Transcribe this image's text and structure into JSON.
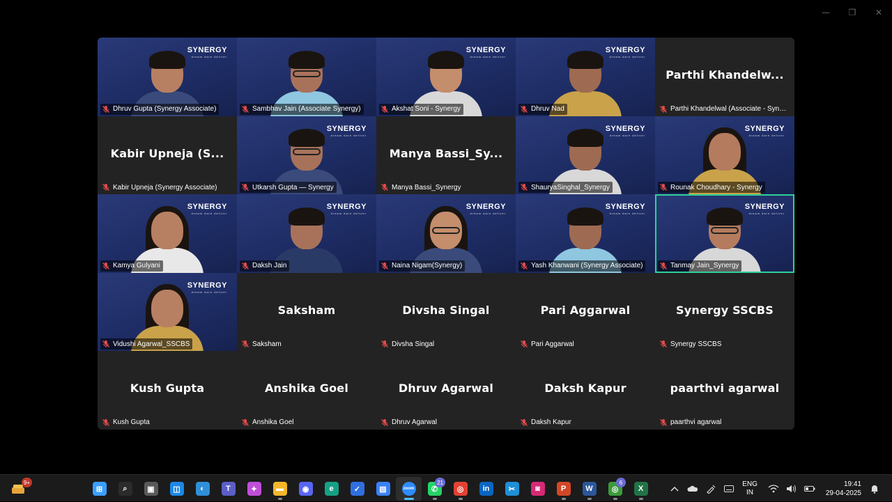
{
  "window": {
    "minimize_glyph": "—",
    "maximize_glyph": "❐",
    "close_glyph": "✕"
  },
  "gallery": {
    "accent_active": "#2ed19a",
    "logo_text": "SYNERGY",
    "logo_tagline": "dream dare deliver",
    "participants": [
      {
        "label": "Dhruv Gupta (Synergy Associate)",
        "video": true,
        "logo": true
      },
      {
        "label": "Sambhav Jain (Associate Synergy)",
        "video": true,
        "logo": false,
        "glasses": true
      },
      {
        "label": "Akshat Soni - Synergy",
        "video": true,
        "logo": true
      },
      {
        "label": "Dhruv Nad",
        "video": true,
        "logo": true
      },
      {
        "label": "Parthi Khandelwal (Associate - Syner...",
        "big_name": "Parthi  Khandelw...",
        "video": false
      },
      {
        "label": "Kabir Upneja (Synergy Associate)",
        "big_name": "Kabir  Upneja  (S...",
        "video": false
      },
      {
        "label": "Utkarsh Gupta — Synergy",
        "video": true,
        "logo": true,
        "glasses": true
      },
      {
        "label": "Manya Bassi_Synergy",
        "big_name": "Manya  Bassi_Sy...",
        "video": false
      },
      {
        "label": "ShauryaSinghal_Synergy",
        "video": true,
        "logo": true
      },
      {
        "label": "Rounak Choudhary - Synergy",
        "video": true,
        "logo": true,
        "long_hair": true
      },
      {
        "label": "Kamya Gulyani",
        "video": true,
        "logo": true,
        "long_hair": true
      },
      {
        "label": "Daksh Jain",
        "video": true,
        "logo": true
      },
      {
        "label": "Naina Nigam(Synergy)",
        "video": true,
        "logo": true,
        "long_hair": true,
        "glasses": true
      },
      {
        "label": "Yash Khanwani (Synergy Associate)",
        "video": true,
        "logo": true
      },
      {
        "label": "Tanmay Jain_Synergy",
        "video": true,
        "logo": true,
        "active": true,
        "glasses": true
      },
      {
        "label": "Vidushi Agarwal_SSCBS",
        "video": true,
        "logo": true,
        "long_hair": true
      },
      {
        "label": "Saksham",
        "big_name": "Saksham",
        "video": false
      },
      {
        "label": "Divsha Singal",
        "big_name": "Divsha Singal",
        "video": false
      },
      {
        "label": "Pari Aggarwal",
        "big_name": "Pari Aggarwal",
        "video": false
      },
      {
        "label": "Synergy SSCBS",
        "big_name": "Synergy SSCBS",
        "video": false
      },
      {
        "label": "Kush Gupta",
        "big_name": "Kush Gupta",
        "video": false
      },
      {
        "label": "Anshika Goel",
        "big_name": "Anshika Goel",
        "video": false
      },
      {
        "label": "Dhruv Agarwal",
        "big_name": "Dhruv Agarwal",
        "video": false
      },
      {
        "label": "Daksh Kapur",
        "big_name": "Daksh Kapur",
        "video": false
      },
      {
        "label": "paarthvi agarwal",
        "big_name": "paarthvi agarwal",
        "video": false
      }
    ]
  },
  "taskbar": {
    "weather_badge": "9+",
    "apps": [
      {
        "name": "start-icon",
        "glyph": "⊞",
        "color": "#3aa0ff"
      },
      {
        "name": "search-icon",
        "glyph": "⌕",
        "color": "#2b2b2b"
      },
      {
        "name": "task-view-icon",
        "glyph": "▣",
        "color": "#5a5a5a"
      },
      {
        "name": "widgets-icon",
        "glyph": "◫",
        "color": "#1e88e5"
      },
      {
        "name": "edge-dev-icon",
        "glyph": "◐",
        "color": "#2f8fd8"
      },
      {
        "name": "teams-icon",
        "glyph": "T",
        "color": "#5b5fc7"
      },
      {
        "name": "copilot-icon",
        "glyph": "✦",
        "color": "#c04fd8"
      },
      {
        "name": "file-explorer-icon",
        "glyph": "▬",
        "color": "#f3b72a",
        "running": true
      },
      {
        "name": "discord-icon",
        "glyph": "◉",
        "color": "#5865f2"
      },
      {
        "name": "edge-icon",
        "glyph": "e",
        "color": "#16a085"
      },
      {
        "name": "todo-icon",
        "glyph": "✓",
        "color": "#2f6fe0"
      },
      {
        "name": "store-icon",
        "glyph": "▤",
        "color": "#3b82f6"
      },
      {
        "name": "zoom-icon",
        "glyph": "zoom",
        "color": "#2d8cff",
        "running": true,
        "focused": true
      },
      {
        "name": "whatsapp-icon",
        "glyph": "✆",
        "color": "#25d366",
        "badge": "21",
        "running": true
      },
      {
        "name": "chrome-icon",
        "glyph": "◎",
        "color": "#e34133",
        "running": true
      },
      {
        "name": "linkedin-icon",
        "glyph": "in",
        "color": "#0a66c2"
      },
      {
        "name": "snipping-tool-icon",
        "glyph": "✂",
        "color": "#1d90d6"
      },
      {
        "name": "instagram-icon",
        "glyph": "◙",
        "color": "#d62976"
      },
      {
        "name": "powerpoint-icon",
        "glyph": "P",
        "color": "#d24726",
        "running": true
      },
      {
        "name": "word-icon",
        "glyph": "W",
        "color": "#2b579a",
        "running": true
      },
      {
        "name": "chrome-profile-icon",
        "glyph": "◎",
        "color": "#3c9a3c",
        "badge": "6",
        "running": true
      },
      {
        "name": "excel-icon",
        "glyph": "X",
        "color": "#217346",
        "running": true
      }
    ],
    "lang_line1": "ENG",
    "lang_line2": "IN",
    "time": "19:41",
    "date": "29-04-2025"
  }
}
